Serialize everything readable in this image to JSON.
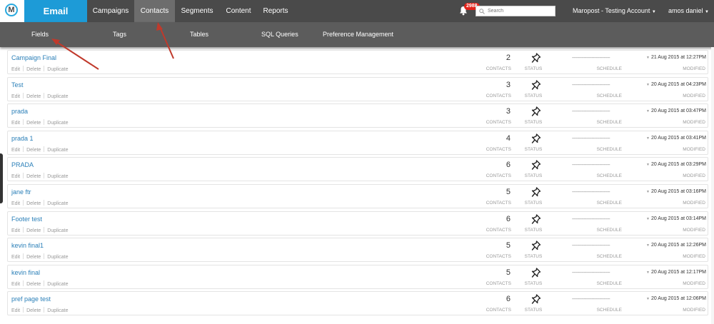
{
  "header": {
    "logo_letter": "M",
    "app_name": "Email",
    "nav": [
      "Campaigns",
      "Contacts",
      "Segments",
      "Content",
      "Reports"
    ],
    "active_nav": "Contacts",
    "notification_count": "2988",
    "search_placeholder": "Search",
    "account_name": "Maropost - Testing Account",
    "user_name": "amos daniel"
  },
  "subnav": [
    "Fields",
    "Tags",
    "Tables",
    "SQL Queries",
    "Preference Management"
  ],
  "labels": {
    "edit": "Edit",
    "delete": "Delete",
    "duplicate": "Duplicate",
    "contacts": "CONTACTS",
    "status": "STATUS",
    "schedule": "SCHEDULE",
    "modified": "MODIFIED",
    "schedule_placeholder": "-----------------------------"
  },
  "rows": [
    {
      "name": "Campaign Final",
      "contacts": "2",
      "modified": "21 Aug 2015 at 12:27PM"
    },
    {
      "name": "Test",
      "contacts": "3",
      "modified": "20 Aug 2015 at 04:23PM"
    },
    {
      "name": "prada",
      "contacts": "3",
      "modified": "20 Aug 2015 at 03:47PM"
    },
    {
      "name": "prada 1",
      "contacts": "4",
      "modified": "20 Aug 2015 at 03:41PM"
    },
    {
      "name": "PRADA",
      "contacts": "6",
      "modified": "20 Aug 2015 at 03:29PM"
    },
    {
      "name": "jane ftr",
      "contacts": "5",
      "modified": "20 Aug 2015 at 03:16PM"
    },
    {
      "name": "Footer test",
      "contacts": "6",
      "modified": "20 Aug 2015 at 03:14PM"
    },
    {
      "name": "kevin final1",
      "contacts": "5",
      "modified": "20 Aug 2015 at 12:26PM"
    },
    {
      "name": "kevin final",
      "contacts": "5",
      "modified": "20 Aug 2015 at 12:17PM"
    },
    {
      "name": "pref page test",
      "contacts": "6",
      "modified": "20 Aug 2015 at 12:06PM"
    }
  ],
  "colors": {
    "brand": "#1d9bd7",
    "topbar": "#4a4a4a",
    "subnav": "#5c5c5c",
    "link": "#2a7fb8",
    "annotation_arrow": "#c0392b"
  }
}
